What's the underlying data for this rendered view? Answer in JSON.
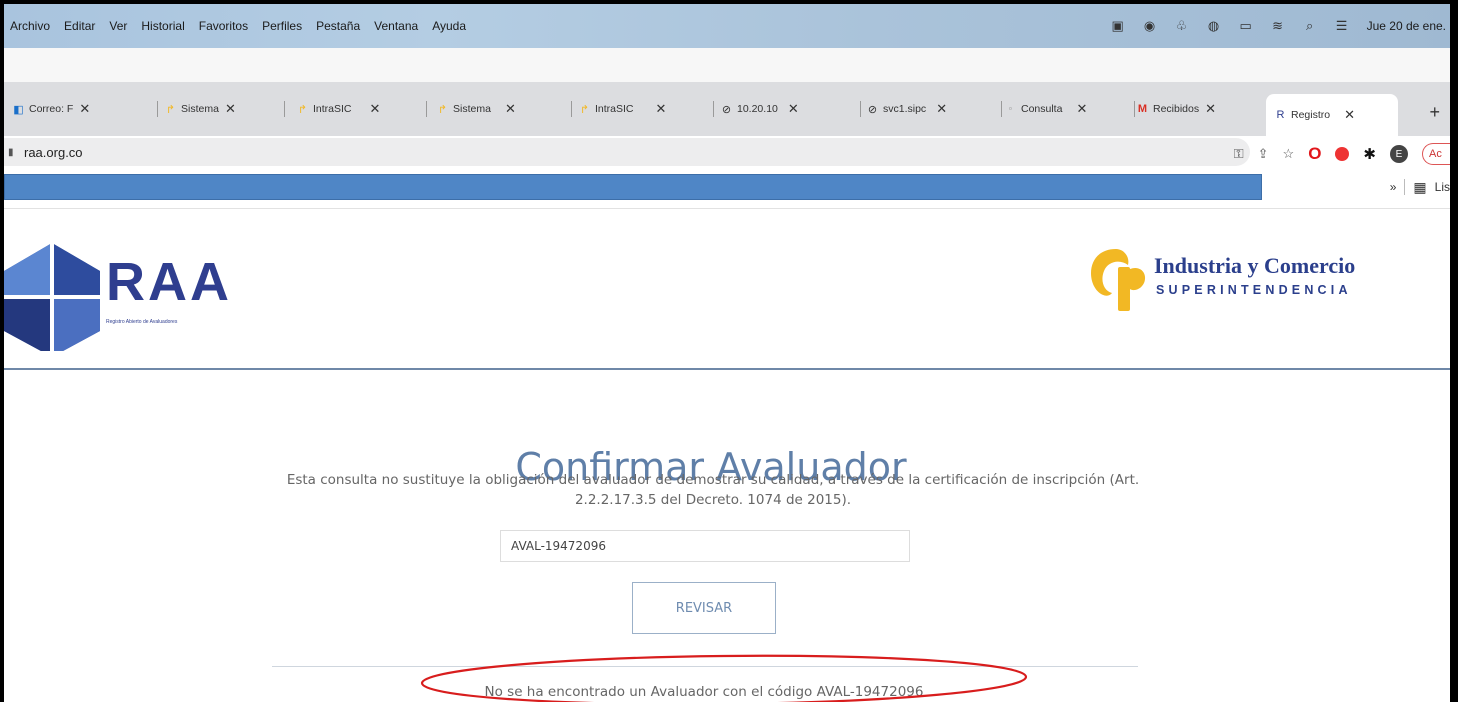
{
  "menubar": {
    "items": [
      "Archivo",
      "Editar",
      "Ver",
      "Historial",
      "Favoritos",
      "Perfiles",
      "Pestaña",
      "Ventana",
      "Ayuda"
    ],
    "clock": "Jue 20 de ene."
  },
  "tabs": [
    {
      "label": "Correo: F",
      "icon": "outlook-icon"
    },
    {
      "label": "Sistema",
      "icon": "sic-icon"
    },
    {
      "label": "IntraSIC",
      "icon": "sic-icon"
    },
    {
      "label": "Sistema",
      "icon": "sic-icon"
    },
    {
      "label": "IntraSIC",
      "icon": "sic-icon"
    },
    {
      "label": "10.20.10",
      "icon": "globe-icon"
    },
    {
      "label": "svc1.sipc",
      "icon": "globe-icon"
    },
    {
      "label": "Consulta",
      "icon": "dots-icon"
    },
    {
      "label": "Recibidos",
      "icon": "gmail-icon"
    },
    {
      "label": "Registro",
      "icon": "raa-icon"
    }
  ],
  "address": {
    "url": "raa.org.co"
  },
  "account_pill": "Ac",
  "avatar_letter": "E",
  "bookmarks": {
    "overflow": "»",
    "reading_list": "Lis"
  },
  "page": {
    "logo_text": "RAA",
    "logo_sub": "Registro Abierto de Avaluadores",
    "sic_title": "Industria y Comercio",
    "sic_sub": "SUPERINTENDENCIA",
    "title": "Confirmar Avaluador",
    "disclaimer": "Esta consulta no sustituye la obligación del avaluador de demostrar su calidad, a través de la certificación de inscripción (Art. 2.2.2.17.3.5 del Decreto. 1074 de 2015).",
    "code_value": "AVAL-19472096",
    "button_label": "REVISAR",
    "result": "No se ha encontrado un Avaluador con el código AVAL-19472096"
  },
  "colors": {
    "brand_blue": "#2f3e8f",
    "title_blue": "#5f7fa8",
    "sic_yellow": "#f2b824",
    "annotation_red": "#d81d1d"
  }
}
